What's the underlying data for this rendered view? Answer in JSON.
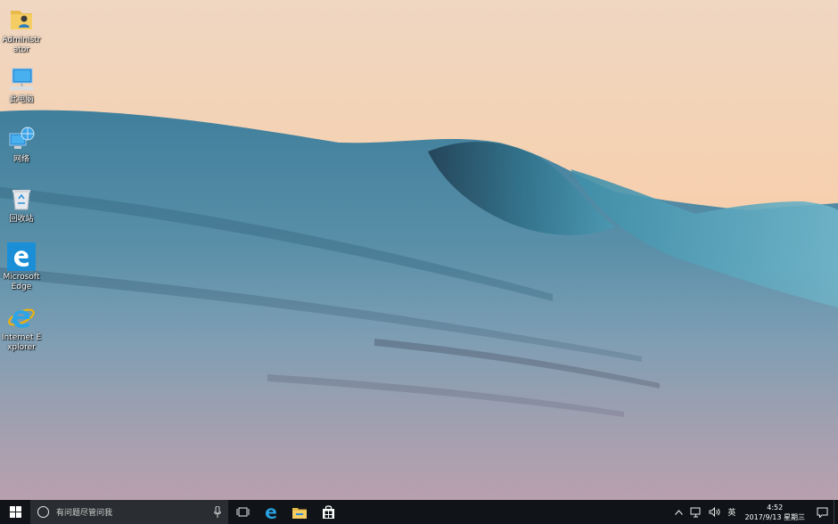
{
  "desktop": {
    "icons": [
      {
        "label": "Administrator",
        "icon": "user-folder-icon"
      },
      {
        "label": "此电脑",
        "icon": "computer-icon"
      },
      {
        "label": "网络",
        "icon": "network-icon"
      },
      {
        "label": "回收站",
        "icon": "recycle-bin-icon"
      },
      {
        "label": "Microsoft Edge",
        "icon": "edge-icon"
      },
      {
        "label": "Internet Explorer",
        "icon": "internet-explorer-icon"
      }
    ]
  },
  "taskbar": {
    "search_placeholder": "有问题尽管问我",
    "pinned": [
      "task-view-icon",
      "edge-icon",
      "file-explorer-icon",
      "store-icon"
    ],
    "tray": {
      "ime": "英",
      "time": "4:52",
      "date": "2017/9/13 星期三"
    }
  },
  "colors": {
    "taskbar": "#101418",
    "search_box": "#2a2d31",
    "accent_blue": "#1a8fd8"
  }
}
